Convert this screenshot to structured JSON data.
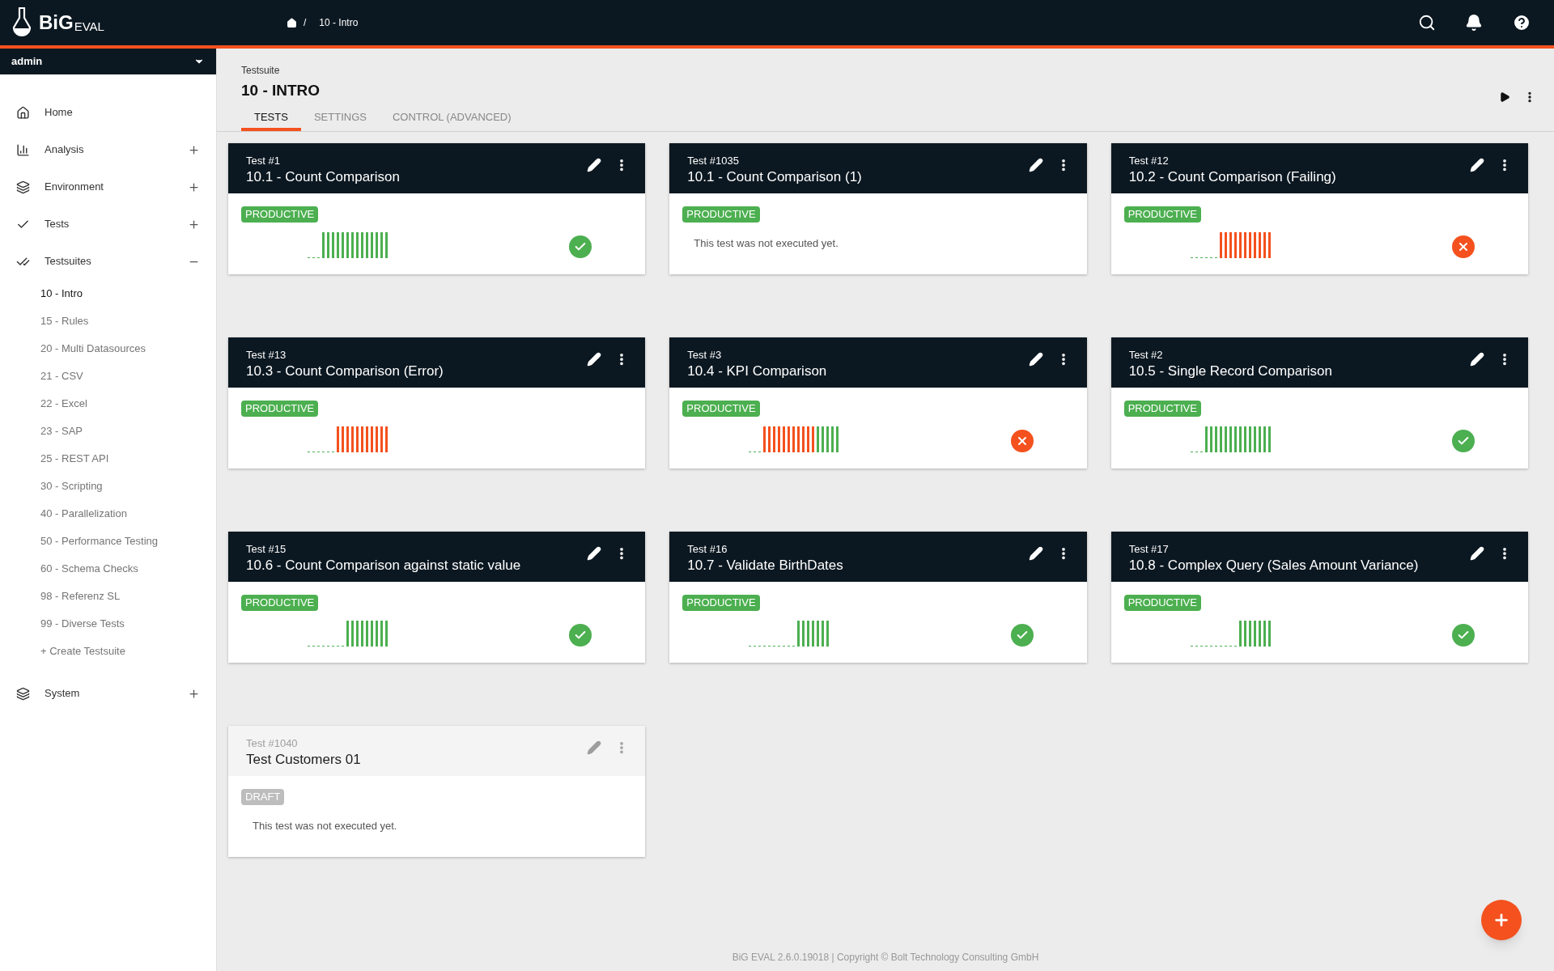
{
  "app": {
    "logo_main": "BiG",
    "logo_sub": "EVAL"
  },
  "breadcrumb": {
    "separator": "/",
    "items": [
      "10 - Intro"
    ]
  },
  "user_menu": {
    "label": "admin"
  },
  "sidebar": {
    "items": [
      {
        "label": "Home"
      },
      {
        "label": "Analysis",
        "expanded": false
      },
      {
        "label": "Environment",
        "expanded": false
      },
      {
        "label": "Tests",
        "expanded": false
      },
      {
        "label": "Testsuites",
        "expanded": true,
        "children": [
          {
            "label": "10 - Intro",
            "selected": true
          },
          {
            "label": "15 - Rules",
            "selected": false
          },
          {
            "label": "20 - Multi Datasources",
            "selected": false
          },
          {
            "label": "21 - CSV",
            "selected": false
          },
          {
            "label": "22 - Excel",
            "selected": false
          },
          {
            "label": "23 - SAP",
            "selected": false
          },
          {
            "label": "25 - REST API",
            "selected": false
          },
          {
            "label": "30 - Scripting",
            "selected": false
          },
          {
            "label": "40 - Parallelization",
            "selected": false
          },
          {
            "label": "50 - Performance Testing",
            "selected": false
          },
          {
            "label": "60 - Schema Checks",
            "selected": false
          },
          {
            "label": "98 - Referenz SL",
            "selected": false
          },
          {
            "label": "99 - Diverse Tests",
            "selected": false
          },
          {
            "label": "+ Create Testsuite",
            "selected": false
          }
        ]
      },
      {
        "label": "System",
        "expanded": false
      }
    ]
  },
  "page": {
    "subtitle": "Testsuite",
    "title": "10 - INTRO"
  },
  "tabs": [
    {
      "label": "TESTS",
      "selected": true
    },
    {
      "label": "SETTINGS",
      "selected": false
    },
    {
      "label": "CONTROL (ADVANCED)",
      "selected": false
    }
  ],
  "tests": [
    {
      "number": "Test #1",
      "name": "10.1 - Count Comparison",
      "draft": false,
      "badge": "PRODUCTIVE",
      "last_run": {
        "passed": true
      },
      "history": [
        {
          "run": false
        },
        {
          "run": false
        },
        {
          "run": false
        },
        {
          "run": true,
          "passed": true
        },
        {
          "run": true,
          "passed": true
        },
        {
          "run": true,
          "passed": true
        },
        {
          "run": true,
          "passed": true
        },
        {
          "run": true,
          "passed": true
        },
        {
          "run": true,
          "passed": true
        },
        {
          "run": true,
          "passed": true
        },
        {
          "run": true,
          "passed": true
        },
        {
          "run": true,
          "passed": true
        },
        {
          "run": true,
          "passed": true
        },
        {
          "run": true,
          "passed": true
        },
        {
          "run": true,
          "passed": true
        },
        {
          "run": true,
          "passed": true
        },
        {
          "run": true,
          "passed": true
        }
      ]
    },
    {
      "number": "Test #1035",
      "name": "10.1 - Count Comparison (1)",
      "draft": false,
      "badge": "PRODUCTIVE",
      "note": "This test was not executed yet."
    },
    {
      "number": "Test #12",
      "name": "10.2 - Count Comparison (Failing)",
      "draft": false,
      "badge": "PRODUCTIVE",
      "last_run": {
        "passed": false
      },
      "history": [
        {
          "run": false
        },
        {
          "run": false
        },
        {
          "run": false
        },
        {
          "run": false
        },
        {
          "run": false
        },
        {
          "run": false
        },
        {
          "run": true,
          "passed": false
        },
        {
          "run": true,
          "passed": false
        },
        {
          "run": true,
          "passed": false
        },
        {
          "run": true,
          "passed": false
        },
        {
          "run": true,
          "passed": false
        },
        {
          "run": true,
          "passed": false
        },
        {
          "run": true,
          "passed": false
        },
        {
          "run": true,
          "passed": false
        },
        {
          "run": true,
          "passed": false
        },
        {
          "run": true,
          "passed": false
        },
        {
          "run": true,
          "passed": false
        }
      ]
    },
    {
      "number": "Test #13",
      "name": "10.3 - Count Comparison (Error)",
      "draft": false,
      "badge": "PRODUCTIVE",
      "history": [
        {
          "run": false
        },
        {
          "run": false
        },
        {
          "run": false
        },
        {
          "run": false
        },
        {
          "run": false
        },
        {
          "run": false
        },
        {
          "run": true,
          "passed": false
        },
        {
          "run": true,
          "passed": false
        },
        {
          "run": true,
          "passed": false
        },
        {
          "run": true,
          "passed": false
        },
        {
          "run": true,
          "passed": false
        },
        {
          "run": true,
          "passed": false
        },
        {
          "run": true,
          "passed": false
        },
        {
          "run": true,
          "passed": false
        },
        {
          "run": true,
          "passed": false
        },
        {
          "run": true,
          "passed": false
        },
        {
          "run": true,
          "passed": false
        }
      ]
    },
    {
      "number": "Test #3",
      "name": "10.4 - KPI Comparison",
      "draft": false,
      "badge": "PRODUCTIVE",
      "last_run": {
        "passed": false
      },
      "history": [
        {
          "run": false
        },
        {
          "run": false
        },
        {
          "run": false
        },
        {
          "run": true,
          "passed": false
        },
        {
          "run": true,
          "passed": false
        },
        {
          "run": true,
          "passed": false
        },
        {
          "run": true,
          "passed": false
        },
        {
          "run": true,
          "passed": false
        },
        {
          "run": true,
          "passed": false
        },
        {
          "run": true,
          "passed": false
        },
        {
          "run": true,
          "passed": false
        },
        {
          "run": true,
          "passed": false
        },
        {
          "run": true,
          "passed": false
        },
        {
          "run": true,
          "passed": false
        },
        {
          "run": true,
          "passed": true
        },
        {
          "run": true,
          "passed": true
        },
        {
          "run": true,
          "passed": true
        },
        {
          "run": true,
          "passed": true
        },
        {
          "run": true,
          "passed": true
        }
      ]
    },
    {
      "number": "Test #2",
      "name": "10.5 - Single Record Comparison",
      "draft": false,
      "badge": "PRODUCTIVE",
      "last_run": {
        "passed": true
      },
      "history": [
        {
          "run": false
        },
        {
          "run": false
        },
        {
          "run": false
        },
        {
          "run": true,
          "passed": true
        },
        {
          "run": true,
          "passed": true
        },
        {
          "run": true,
          "passed": true
        },
        {
          "run": true,
          "passed": true
        },
        {
          "run": true,
          "passed": true
        },
        {
          "run": true,
          "passed": true
        },
        {
          "run": true,
          "passed": true
        },
        {
          "run": true,
          "passed": true
        },
        {
          "run": true,
          "passed": true
        },
        {
          "run": true,
          "passed": true
        },
        {
          "run": true,
          "passed": true
        },
        {
          "run": true,
          "passed": true
        },
        {
          "run": true,
          "passed": true
        },
        {
          "run": true,
          "passed": true
        }
      ]
    },
    {
      "number": "Test #15",
      "name": "10.6 - Count Comparison against static value",
      "draft": false,
      "badge": "PRODUCTIVE",
      "last_run": {
        "passed": true
      },
      "history": [
        {
          "run": false
        },
        {
          "run": false
        },
        {
          "run": false
        },
        {
          "run": false
        },
        {
          "run": false
        },
        {
          "run": false
        },
        {
          "run": false
        },
        {
          "run": false
        },
        {
          "run": true,
          "passed": true
        },
        {
          "run": true,
          "passed": true
        },
        {
          "run": true,
          "passed": true
        },
        {
          "run": true,
          "passed": true
        },
        {
          "run": true,
          "passed": true
        },
        {
          "run": true,
          "passed": true
        },
        {
          "run": true,
          "passed": true
        },
        {
          "run": true,
          "passed": true
        },
        {
          "run": true,
          "passed": true
        }
      ]
    },
    {
      "number": "Test #16",
      "name": "10.7 - Validate BirthDates",
      "draft": false,
      "badge": "PRODUCTIVE",
      "last_run": {
        "passed": true
      },
      "history": [
        {
          "run": false
        },
        {
          "run": false
        },
        {
          "run": false
        },
        {
          "run": false
        },
        {
          "run": false
        },
        {
          "run": false
        },
        {
          "run": false
        },
        {
          "run": false
        },
        {
          "run": false
        },
        {
          "run": false
        },
        {
          "run": true,
          "passed": true
        },
        {
          "run": true,
          "passed": true
        },
        {
          "run": true,
          "passed": true
        },
        {
          "run": true,
          "passed": true
        },
        {
          "run": true,
          "passed": true
        },
        {
          "run": true,
          "passed": true
        },
        {
          "run": true,
          "passed": true
        }
      ]
    },
    {
      "number": "Test #17",
      "name": "10.8 - Complex Query (Sales Amount Variance)",
      "draft": false,
      "badge": "PRODUCTIVE",
      "last_run": {
        "passed": true
      },
      "history": [
        {
          "run": false
        },
        {
          "run": false
        },
        {
          "run": false
        },
        {
          "run": false
        },
        {
          "run": false
        },
        {
          "run": false
        },
        {
          "run": false
        },
        {
          "run": false
        },
        {
          "run": false
        },
        {
          "run": false
        },
        {
          "run": true,
          "passed": true
        },
        {
          "run": true,
          "passed": true
        },
        {
          "run": true,
          "passed": true
        },
        {
          "run": true,
          "passed": true
        },
        {
          "run": true,
          "passed": true
        },
        {
          "run": true,
          "passed": true
        },
        {
          "run": true,
          "passed": true
        }
      ]
    },
    {
      "number": "Test #1040",
      "name": "Test Customers 01",
      "draft": true,
      "badge": "DRAFT",
      "note": "This test was not executed yet."
    }
  ],
  "footer": "BiG EVAL 2.6.0.19018 | Copyright © Bolt Technology Consulting GmbH"
}
